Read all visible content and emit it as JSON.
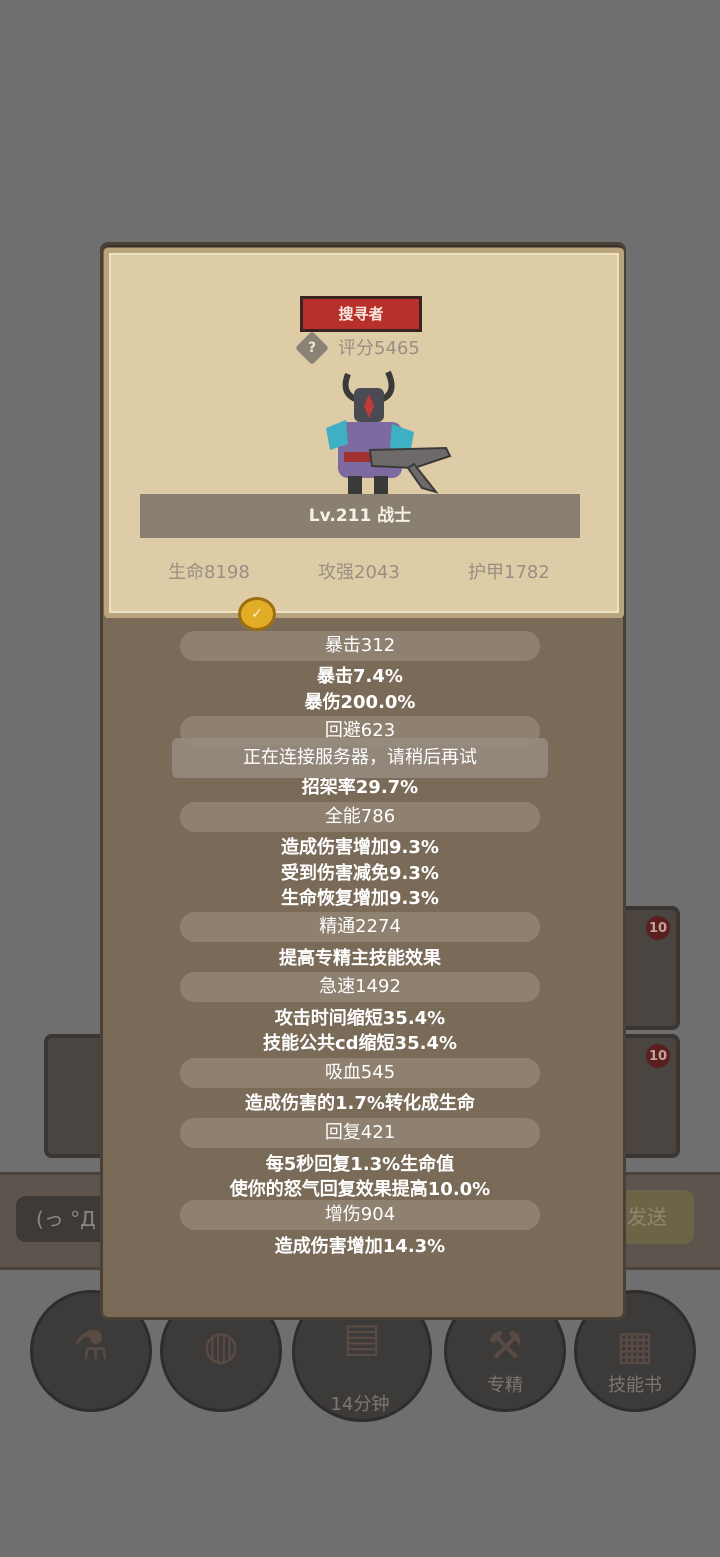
{
  "background": {
    "chat_placeholder": "(っ °Д",
    "send_label": "发送",
    "card_levels": [
      "10",
      "10"
    ],
    "timer": "14分钟",
    "bottom_buttons": [
      {
        "label": "",
        "icon": "potion-icon"
      },
      {
        "label": "",
        "icon": "bread-icon"
      },
      {
        "label": "",
        "icon": "treasure-chest-icon"
      },
      {
        "label": "专精",
        "icon": "axe-icon"
      },
      {
        "label": "技能书",
        "icon": "book-icon"
      }
    ]
  },
  "profile": {
    "class_badge": "搜寻者",
    "score": "评分5465",
    "level": "Lv.211 战士",
    "hp": "生命8198",
    "attack": "攻强2043",
    "armor": "护甲1782"
  },
  "stats": [
    {
      "title": "暴击312",
      "lines": [
        "暴击7.4%",
        "暴伤200.0%"
      ]
    },
    {
      "title": "回避623",
      "lines": [
        "招架率29.7%"
      ]
    },
    {
      "title": "全能786",
      "lines": [
        "造成伤害增加9.3%",
        "受到伤害减免9.3%",
        "生命恢复增加9.3%"
      ]
    },
    {
      "title": "精通2274",
      "lines": [
        "提高专精主技能效果"
      ]
    },
    {
      "title": "急速1492",
      "lines": [
        "攻击时间缩短35.4%",
        "技能公共cd缩短35.4%"
      ]
    },
    {
      "title": "吸血545",
      "lines": [
        "造成伤害的1.7%转化成生命"
      ]
    },
    {
      "title": "回复421",
      "lines": [
        "每5秒回复1.3%生命值",
        "使你的怒气回复效果提高10.0%"
      ]
    },
    {
      "title": "增伤904",
      "lines": [
        "造成伤害增加14.3%"
      ]
    }
  ],
  "toast": "正在连接服务器，请稍后再试"
}
